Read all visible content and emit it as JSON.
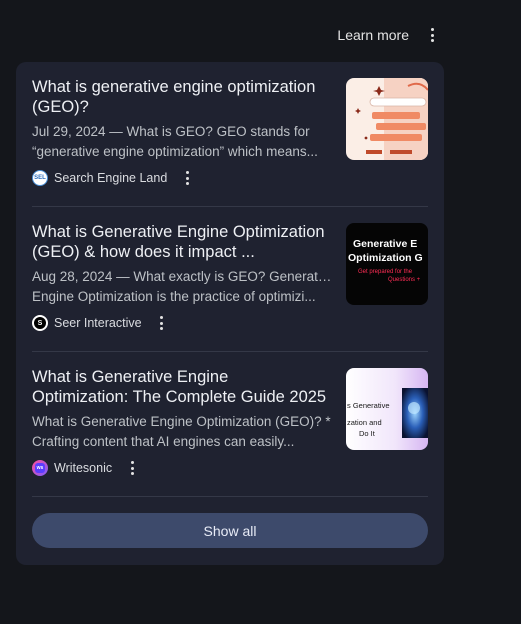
{
  "header": {
    "learn_more": "Learn more",
    "menu_icon": "more-vert-icon"
  },
  "results": [
    {
      "title": "What is generative engine optimization (GEO)?",
      "snippet_line1": "Jul 29, 2024 — What is GEO? GEO stands for",
      "snippet_line2": "“generative engine optimization” which means...",
      "source": "Search Engine Land",
      "favicon_text": "SEL",
      "thumbnail": "thumbnail-geo-illustration"
    },
    {
      "title": "What is Generative Engine Optimization (GEO) & how does it impact ...",
      "snippet_line1": "Aug 28, 2024 — What exactly is GEO? Generative",
      "snippet_line2": "Engine Optimization is the practice of optimizi...",
      "source": "Seer Interactive",
      "favicon_text": "S",
      "thumbnail": "thumbnail-geo-black-banner",
      "thumb_text_line1": "Generative E",
      "thumb_text_line2": "Optimization G",
      "thumb_text_line3": "Get prepared for the",
      "thumb_text_line4": "Questions +"
    },
    {
      "title": "What is Generative Engine Optimization: The Complete Guide 2025",
      "snippet_line1": "What is Generative Engine Optimization (GEO)? *",
      "snippet_line2": "Crafting content that AI engines can easily...",
      "source": "Writesonic",
      "favicon_text": "ws",
      "thumbnail": "thumbnail-geo-guide",
      "thumb_text_line1": "s Generative",
      "thumb_text_line2": "zation and",
      "thumb_text_line3": "Do It"
    }
  ],
  "show_all": "Show all",
  "colors": {
    "background": "#14161b",
    "card": "#1f2230",
    "button": "#3d4a6b",
    "accent_pink": "#ff2d55"
  }
}
